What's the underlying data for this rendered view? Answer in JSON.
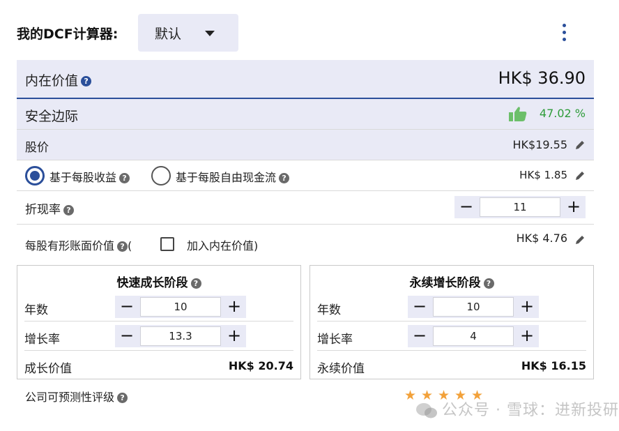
{
  "header": {
    "title": "我的DCF计算器:",
    "preset": "默认"
  },
  "intrinsic": {
    "label": "内在价值",
    "value": "HK$ 36.90"
  },
  "margin": {
    "label": "安全边际",
    "value": "47.02 %"
  },
  "price": {
    "label": "股价",
    "value": "HK$19.55"
  },
  "basis": {
    "option_eps": "基于每股收益",
    "option_fcf": "基于每股自由现金流",
    "selected": "option_eps",
    "value": "HK$ 1.85"
  },
  "discount": {
    "label": "折现率",
    "value": "11"
  },
  "tangible": {
    "label": "每股有形账面价值",
    "open_paren": "(",
    "checkbox_label": "加入内在价值)",
    "value": "HK$ 4.76"
  },
  "growth_stage": {
    "title": "快速成长阶段",
    "years_label": "年数",
    "years": "10",
    "rate_label": "增长率",
    "rate": "13.3",
    "value_label": "成长价值",
    "value": "HK$ 20.74"
  },
  "terminal_stage": {
    "title": "永续增长阶段",
    "years_label": "年数",
    "years": "10",
    "rate_label": "增长率",
    "rate": "4",
    "value_label": "永续价值",
    "value": "HK$ 16.15"
  },
  "predictability": {
    "label": "公司可预测性评级",
    "stars": 5
  },
  "watermark": "公众号 · 雪球：进新投研",
  "icons": {
    "help": "?",
    "minus": "−",
    "plus": "+",
    "star": "★"
  },
  "colors": {
    "accent": "#2b4f9a",
    "positive": "#2e9c3a",
    "panel_shade": "#e9eaf6",
    "star": "#f2a13a"
  }
}
